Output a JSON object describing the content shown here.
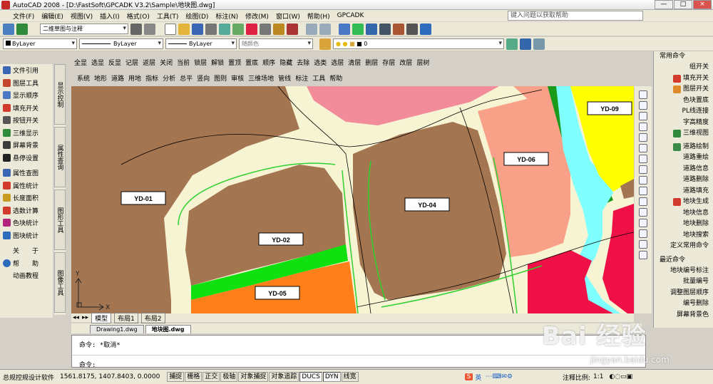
{
  "app": {
    "title": "AutoCAD 2008 - [D:\\FastSoft\\GPCADK V3.2\\Sample\\地块图.dwg]",
    "help_placeholder": "键入问题以获取帮助",
    "win_min": "—",
    "win_max": "□",
    "win_close": "×"
  },
  "menu": [
    "文件(F)",
    "编辑(E)",
    "视图(V)",
    "插入(I)",
    "格式(O)",
    "工具(T)",
    "绘图(D)",
    "标注(N)",
    "修改(M)",
    "窗口(W)",
    "帮助(H)",
    "GPCADK"
  ],
  "toolbar": {
    "workspace": "二维草图与注释",
    "layer_color": "ByLayer",
    "linetype": "ByLayer",
    "lineweight": "ByLayer",
    "plotstyle": "随颜色",
    "layer_name": "0"
  },
  "command_row_1": [
    "全显",
    "选显",
    "反显",
    "记层",
    "返层",
    "关闭",
    "当前",
    "锁层",
    "解锁",
    "置顶",
    "置底",
    "顺序",
    "隐藏",
    "去除",
    "选类",
    "选层",
    "清层",
    "删层",
    "存层",
    "改层",
    "层树"
  ],
  "command_row_2": [
    "系统",
    "地形",
    "道路",
    "用地",
    "指标",
    "分析",
    "总平",
    "竖向",
    "图则",
    "审核",
    "三维场地",
    "管线",
    "标注",
    "工具",
    "帮助"
  ],
  "left_panel": [
    {
      "label": "文件引用",
      "color": "#3a66b3"
    },
    {
      "label": "图层工具",
      "color": "#c4462c"
    },
    {
      "label": "显示顺序",
      "color": "#4a78c4"
    },
    {
      "label": "填充开关",
      "color": "#d23b2b"
    },
    {
      "label": "按钮开关",
      "color": "#555555"
    },
    {
      "label": "三维显示",
      "color": "#2f8b3a"
    },
    {
      "label": "屏幕背景",
      "color": "#3c3c3c"
    },
    {
      "label": "悬停设置",
      "color": "#222222"
    },
    {
      "label": "属性查图",
      "color": "#3a66b3"
    },
    {
      "label": "属性统计",
      "color": "#d23b2b"
    },
    {
      "label": "长度面积",
      "color": "#c89b20"
    },
    {
      "label": "选数计算",
      "color": "#d23b2b"
    },
    {
      "label": "色块统计",
      "color": "#b2227a"
    },
    {
      "label": "图块统计",
      "color": "#2d6bbd"
    },
    {
      "label": "关　　于",
      "color": "#ece9d8"
    },
    {
      "label": "帮　　助",
      "color": "#2d6bbd"
    },
    {
      "label": "动画教程",
      "color": "#ece9d8"
    }
  ],
  "left_tabs": [
    "显示控制",
    "属性查询",
    "图形工具",
    "图像工具"
  ],
  "right_panel": {
    "section1_title": "常用命令",
    "section1": [
      "组开关",
      "填充开关",
      "图层开关",
      "色块置底",
      "PL线连接",
      "字高精度",
      "三维视图",
      "道路绘制",
      "道路重绘",
      "道路信息",
      "道路删除",
      "道路填充",
      "地块生成",
      "地块信息",
      "地块删除",
      "地块搜索",
      "定义常用命令"
    ],
    "section2_title": "最近命令",
    "section2": [
      "地块编号标注",
      "批量编号",
      "调整图层顺序",
      "编号删除",
      "屏幕背景色"
    ]
  },
  "parcels": {
    "yd01": "YD-01",
    "yd02": "YD-02",
    "yd04": "YD-04",
    "yd05": "YD-05",
    "yd06": "YD-06",
    "yd09": "YD-09"
  },
  "ucs": {
    "y": "Y",
    "x": "X"
  },
  "layout_tabs": [
    "模型",
    "布局1",
    "布局2"
  ],
  "doc_tabs": [
    "Drawing1.dwg",
    "地块图.dwg"
  ],
  "command_lines": [
    "命令: *取消*",
    "命令:"
  ],
  "status": {
    "app_name": "总规控规设计软件",
    "coords": "1561.8175, 1407.8403, 0.0000",
    "toggles": [
      "捕捉",
      "栅格",
      "正交",
      "极轴",
      "对象捕捉",
      "对象追踪",
      "DUCS",
      "DYN",
      "线宽"
    ],
    "scale_label": "注释比例:",
    "scale_value": "1:1",
    "ime_label": "英"
  },
  "watermark": {
    "main": "Bai 经验",
    "sub": "jingyan.baidu.com"
  },
  "colors": {
    "brown": "#a47551",
    "pink": "#f28c9a",
    "salmon": "#f8a088",
    "orange": "#ff7f1a",
    "yellow": "#ffff00",
    "cyan": "#80ffff",
    "green": "#10e010",
    "darkgreen": "#1a9a1a",
    "red": "#f01048",
    "road": "#f7f4d4"
  }
}
